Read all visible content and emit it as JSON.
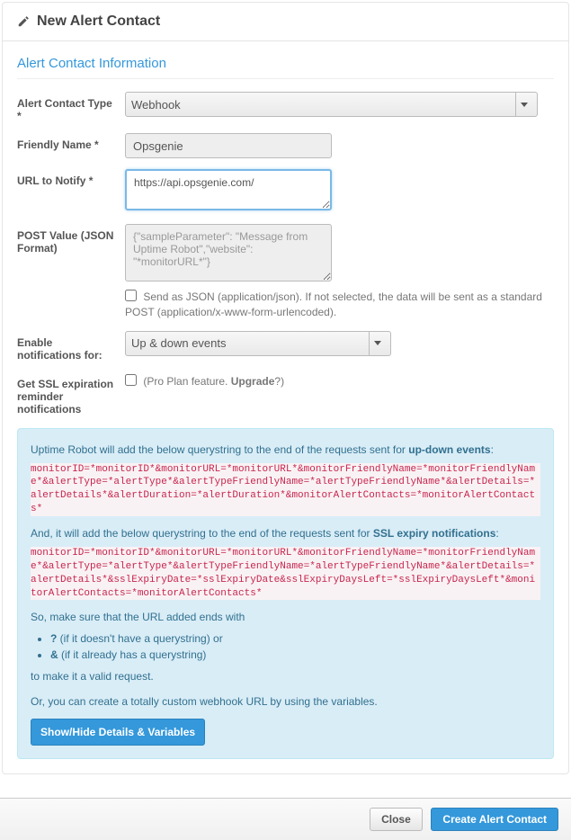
{
  "header": {
    "title": "New Alert Contact"
  },
  "section": {
    "title": "Alert Contact Information"
  },
  "form": {
    "type_label": "Alert Contact Type *",
    "type_value": "Webhook",
    "name_label": "Friendly Name *",
    "name_value": "Opsgenie",
    "url_label": "URL to Notify *",
    "url_value": "https://api.opsgenie.com/",
    "post_label": "POST Value (JSON Format)",
    "post_placeholder": "{\"sampleParameter\": \"Message from Uptime Robot\",\"website\": \"*monitorURL*\"}",
    "post_hint": "Send as JSON (application/json). If not selected, the data will be sent as a standard POST (application/x-www-form-urlencoded).",
    "enable_label": "Enable notifications for:",
    "enable_value": "Up & down events",
    "ssl_label": "Get SSL expiration reminder notifications",
    "ssl_hint_prefix": "(Pro Plan feature. ",
    "ssl_hint_link": "Upgrade",
    "ssl_hint_suffix": "?)"
  },
  "info": {
    "line1_a": "Uptime Robot will add the below querystring to the end of the requests sent for ",
    "line1_b": "up-down events",
    "code1": "monitorID=*monitorID*&monitorURL=*monitorURL*&monitorFriendlyName=*monitorFriendlyName*&alertType=*alertType*&alertTypeFriendlyName=*alertTypeFriendlyName*&alertDetails=*alertDetails*&alertDuration=*alertDuration*&monitorAlertContacts=*monitorAlertContacts*",
    "line2_a": "And, it will add the below querystring to the end of the requests sent for ",
    "line2_b": "SSL expiry notifications",
    "code2": "monitorID=*monitorID*&monitorURL=*monitorURL*&monitorFriendlyName=*monitorFriendlyName*&alertType=*alertType*&alertTypeFriendlyName=*alertTypeFriendlyName*&alertDetails=*alertDetails*&sslExpiryDate=*sslExpiryDate&sslExpiryDaysLeft=*sslExpiryDaysLeft*&monitorAlertContacts=*monitorAlertContacts*",
    "line3": "So, make sure that the URL added ends with",
    "bullet1_mark": "?",
    "bullet1_text": " (if it doesn't have a querystring) or",
    "bullet2_mark": "&",
    "bullet2_text": " (if it already has a querystring)",
    "line4": "to make it a valid request.",
    "line5": "Or, you can create a totally custom webhook URL by using the variables.",
    "toggle_button": "Show/Hide Details & Variables"
  },
  "footer": {
    "close": "Close",
    "create": "Create Alert Contact"
  }
}
